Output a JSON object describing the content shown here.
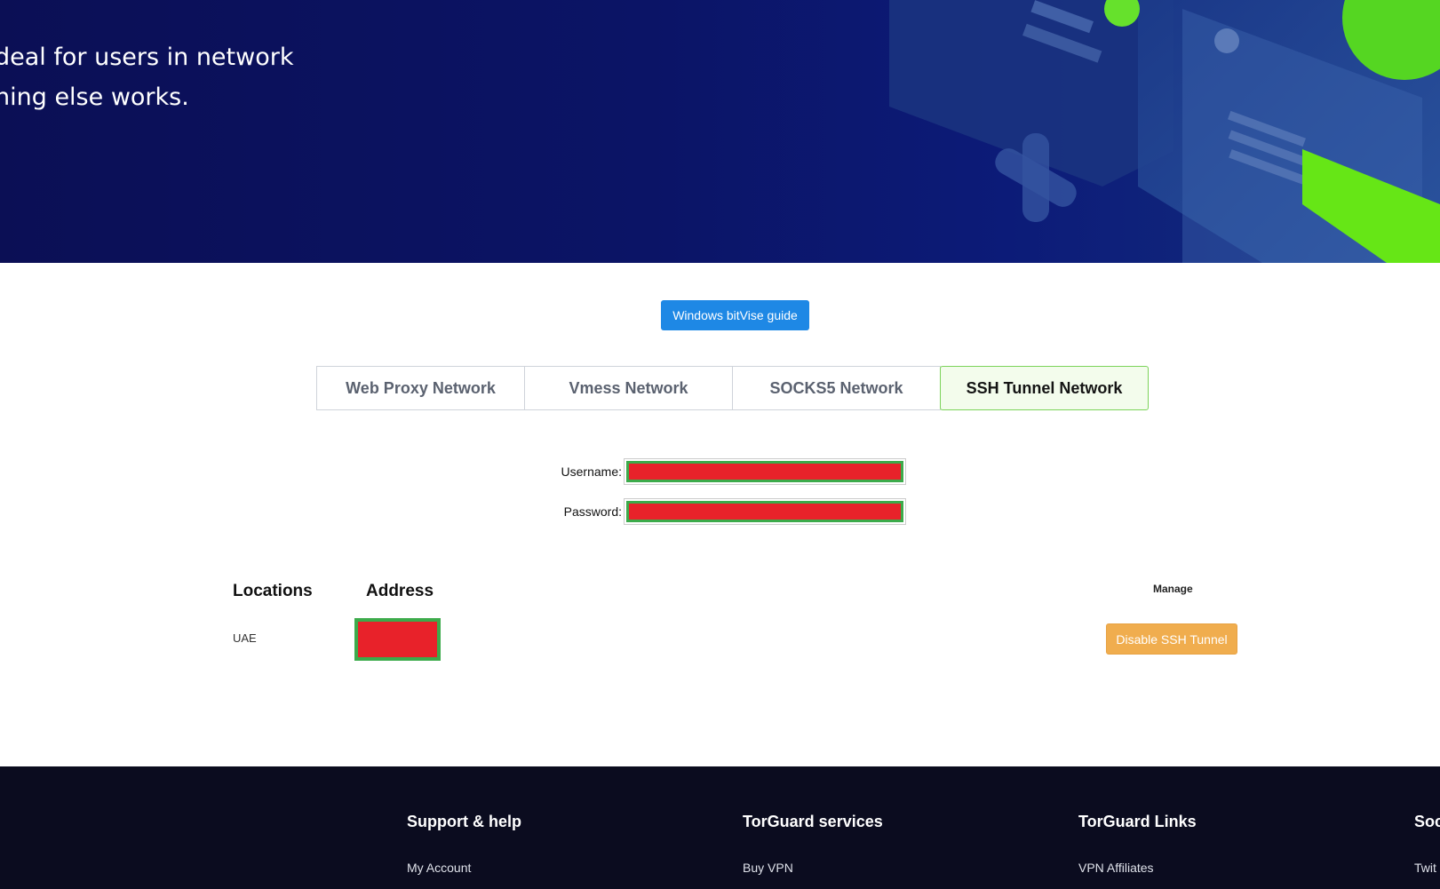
{
  "hero": {
    "line1": "deal for users in network",
    "line2": "hing else works."
  },
  "guide_button": "Windows bitVise guide",
  "tabs": [
    {
      "label": "Web Proxy Network",
      "active": false
    },
    {
      "label": "Vmess Network",
      "active": false
    },
    {
      "label": "SOCKS5 Network",
      "active": false
    },
    {
      "label": "SSH Tunnel Network",
      "active": true
    }
  ],
  "credentials": {
    "username_label": "Username:",
    "password_label": "Password:"
  },
  "table": {
    "col_locations": "Locations",
    "col_address": "Address",
    "col_manage": "Manage",
    "rows": [
      {
        "location": "UAE",
        "action": "Disable SSH Tunnel"
      }
    ]
  },
  "footer": {
    "columns": [
      {
        "heading": "Support & help",
        "link": "My Account"
      },
      {
        "heading": "TorGuard services",
        "link": "Buy VPN"
      },
      {
        "heading": "TorGuard Links",
        "link": "VPN Affiliates"
      },
      {
        "heading": "Soc",
        "link": "Twit"
      }
    ]
  },
  "colors": {
    "primary_button": "#1e88e5",
    "warning_button": "#f0ad4e",
    "redaction_fill": "#e8222a",
    "redaction_border": "#3cab4b",
    "active_tab_border": "#7cd35a"
  }
}
